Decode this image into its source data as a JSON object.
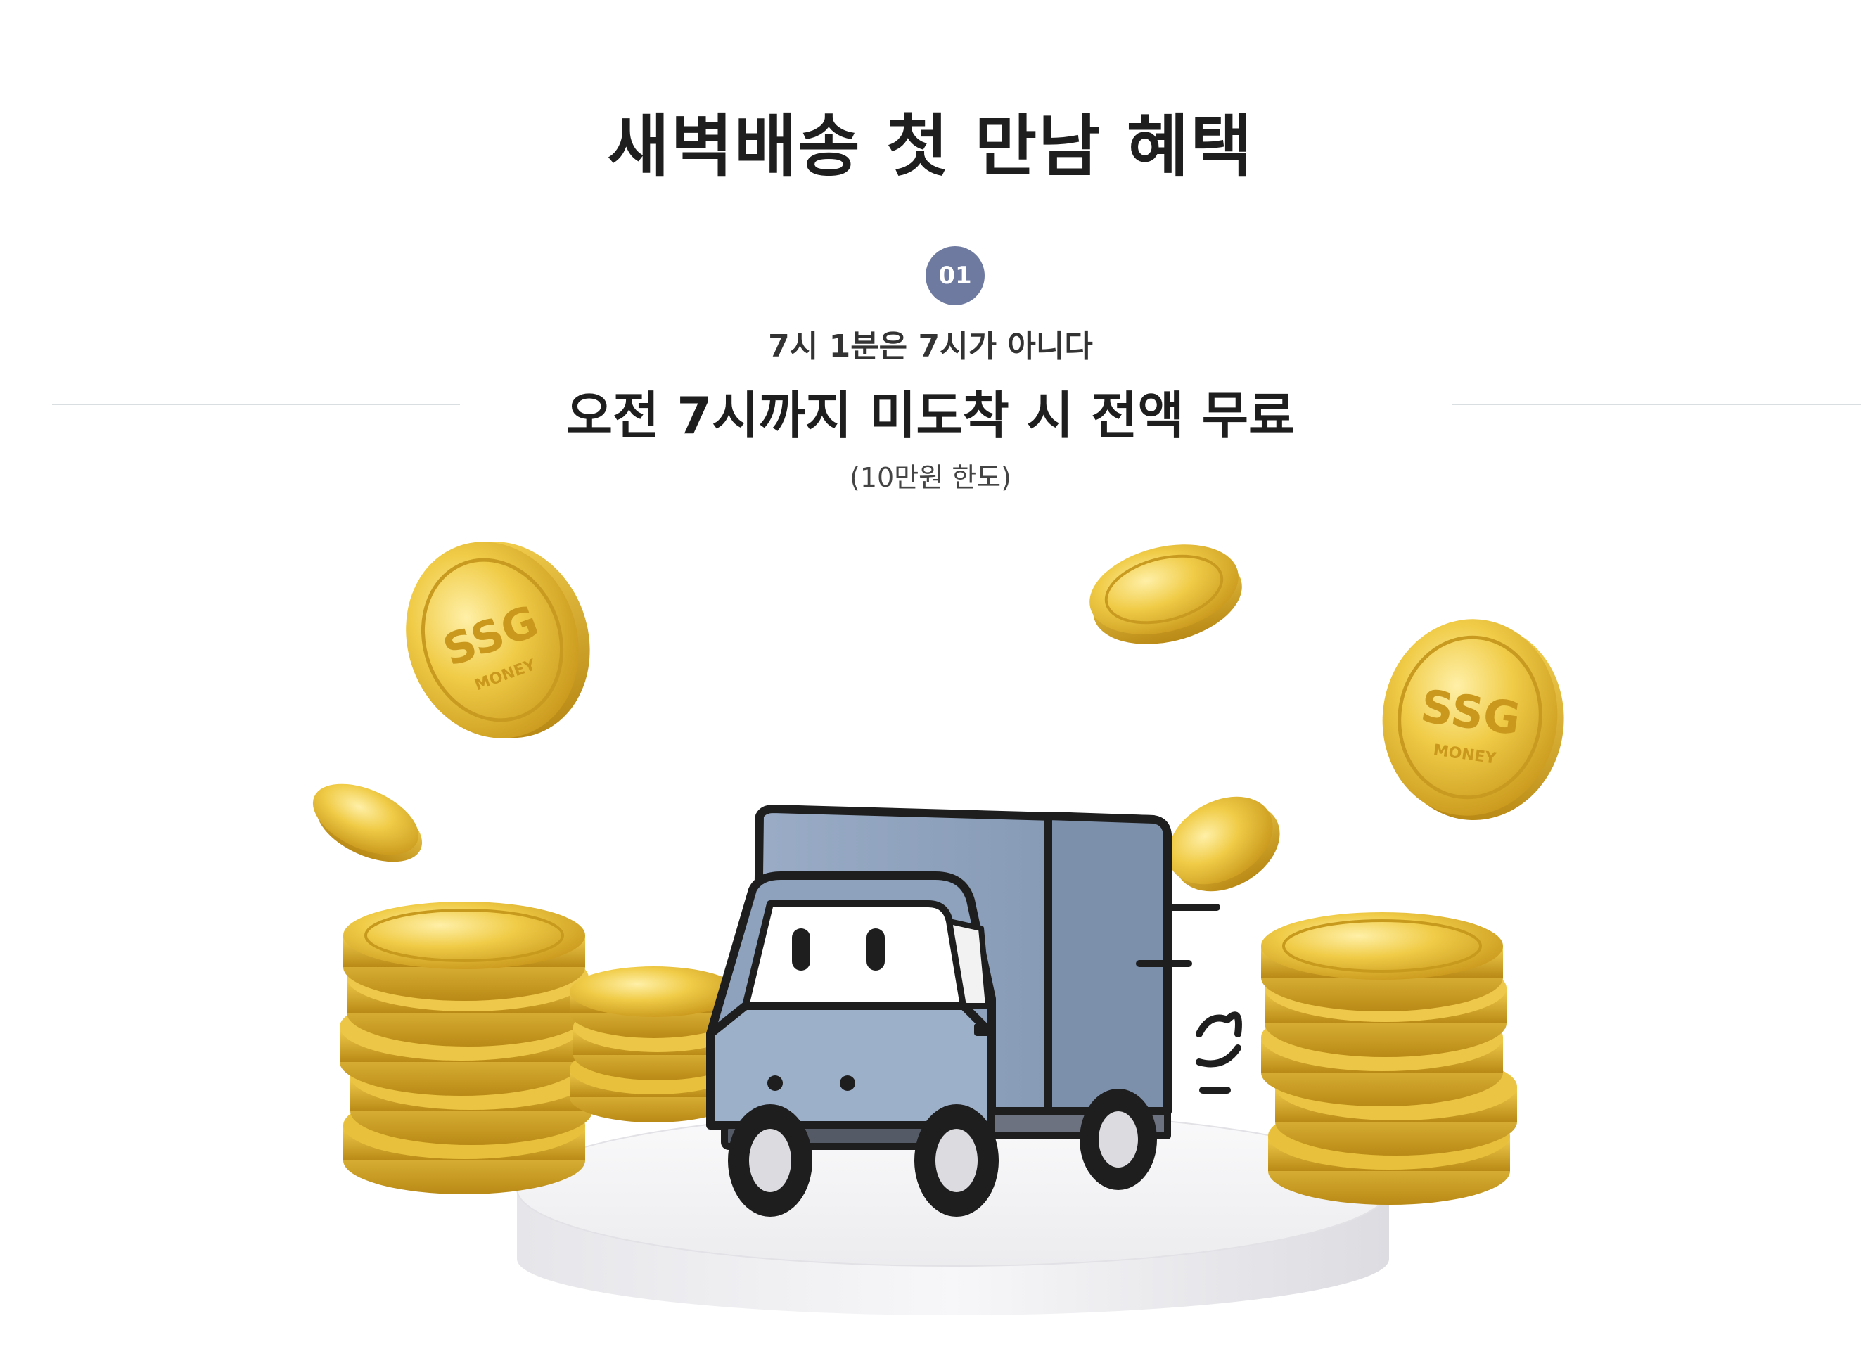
{
  "header": {
    "title": "새벽배송 첫 만남 혜택"
  },
  "benefit": {
    "number": "01",
    "subtitle": "7시 1분은 7시가 아니다",
    "headline": "오전 7시까지 미도착 시 전액 무료",
    "note": "(10만원 한도)"
  },
  "illustration": {
    "coin_text": "SSG",
    "coin_subtext": "MONEY"
  },
  "colors": {
    "badge": "#6e7aa0",
    "truck_body": "#8ea2bd",
    "coin_gold": "#e6be3a",
    "pedestal": "#f0f0f2"
  },
  "icons": [
    "delivery-truck-icon",
    "ssg-money-coin-icon",
    "coin-stack-icon"
  ]
}
